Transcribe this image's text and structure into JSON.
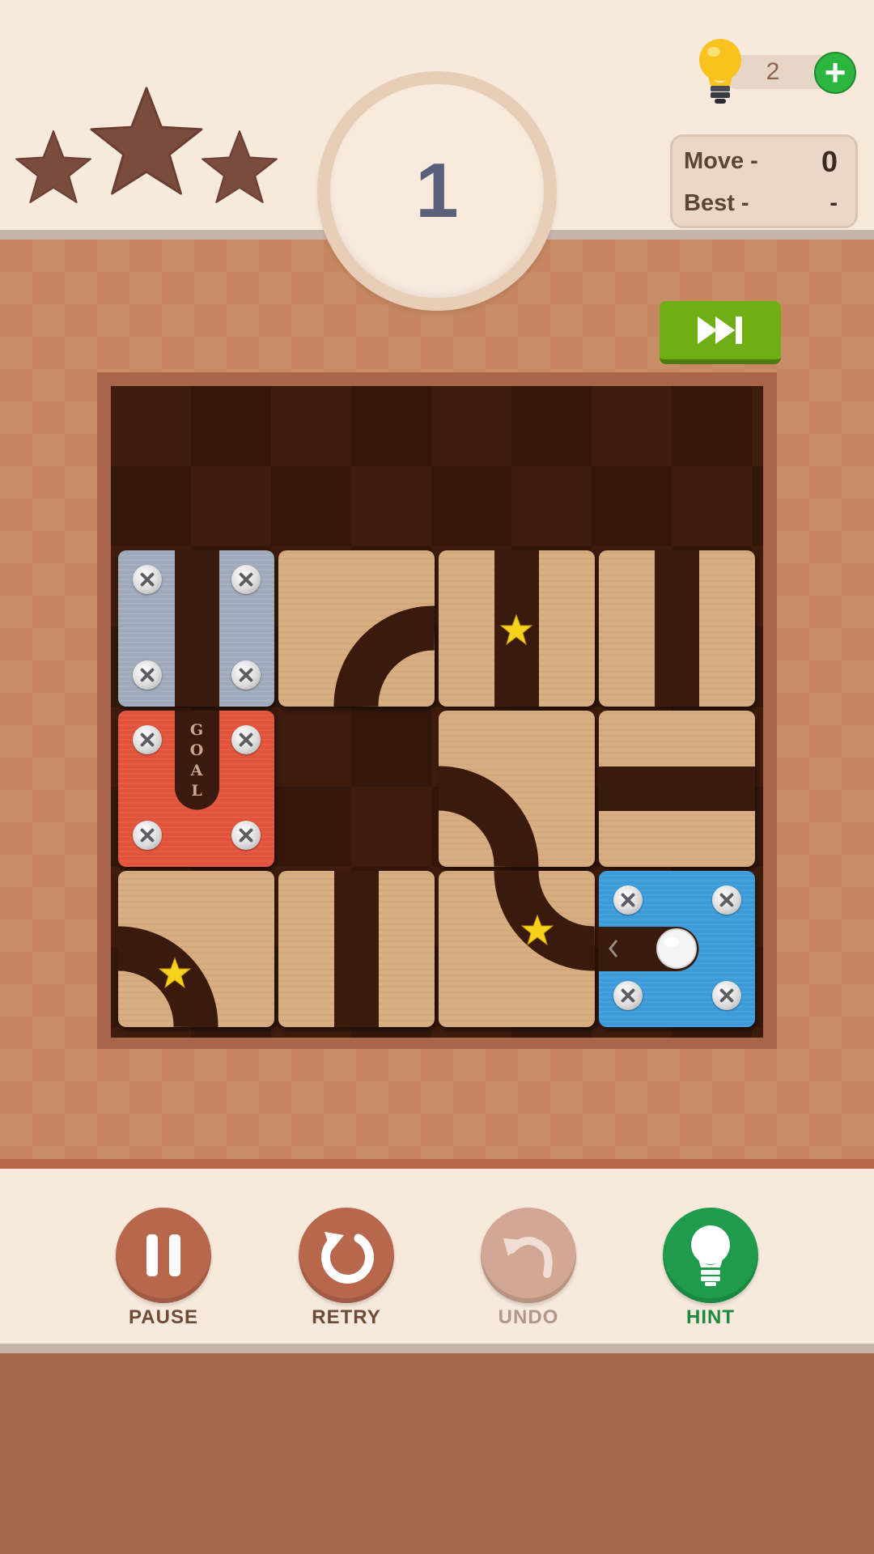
{
  "header": {
    "stars_earned": 0,
    "stars_total": 3,
    "level": "1",
    "hints": {
      "count": "2",
      "add_label": "+"
    },
    "stats": {
      "move_label": "Move -",
      "move_value": "0",
      "best_label": "Best -",
      "best_value": "-"
    }
  },
  "board": {
    "goal_label": "GOAL",
    "colors": {
      "wood": "#d8ad82",
      "steel": "#9ea9bb",
      "goal": "#e2533c",
      "start": "#3c9bd8",
      "channel": "#3a1a0c",
      "star": "#f7d21c"
    }
  },
  "skip_button": {
    "icon": "fast-forward-icon"
  },
  "controls": [
    {
      "label": "PAUSE",
      "icon": "pause-icon",
      "color": "#b8674d",
      "label_color": "#6e4a37"
    },
    {
      "label": "RETRY",
      "icon": "retry-icon",
      "color": "#b8674d",
      "label_color": "#6e4a37"
    },
    {
      "label": "UNDO",
      "icon": "undo-icon",
      "color": "#d2a894",
      "label_color": "#b19787"
    },
    {
      "label": "HINT",
      "icon": "lightbulb-icon",
      "color": "#1e9b4b",
      "label_color": "#1e8a40"
    }
  ]
}
